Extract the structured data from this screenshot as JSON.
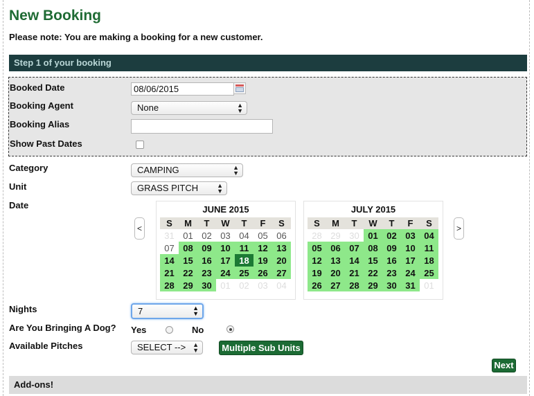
{
  "page": {
    "title": "New Booking",
    "note": "Please note: You are making a booking for a new customer.",
    "step_title": "Step 1 of your booking"
  },
  "form": {
    "booked_date_label": "Booked Date",
    "booked_date_value": "08/06/2015",
    "booking_agent_label": "Booking Agent",
    "booking_agent_value": "None",
    "booking_alias_label": "Booking Alias",
    "booking_alias_value": "",
    "show_past_dates_label": "Show Past Dates",
    "category_label": "Category",
    "category_value": "CAMPING",
    "unit_label": "Unit",
    "unit_value": "GRASS PITCH",
    "date_label": "Date",
    "nights_label": "Nights",
    "nights_value": "7",
    "dog_label": "Are You Bringing A Dog?",
    "dog_yes": "Yes",
    "dog_no": "No",
    "dog_selected": "No",
    "pitches_label": "Available Pitches",
    "pitches_value": "SELECT -->",
    "multiple_sub_units_label": "Multiple Sub Units",
    "next_label": "Next"
  },
  "calendar": {
    "prev_label": "<",
    "next_label": ">",
    "weekdays": [
      "S",
      "M",
      "T",
      "W",
      "T",
      "F",
      "S"
    ],
    "months": [
      {
        "title": "JUNE 2015",
        "weeks": [
          [
            [
              "31",
              "out"
            ],
            [
              "01",
              "past"
            ],
            [
              "02",
              "past"
            ],
            [
              "03",
              "past"
            ],
            [
              "04",
              "past"
            ],
            [
              "05",
              "past"
            ],
            [
              "06",
              "past"
            ]
          ],
          [
            [
              "07",
              "past"
            ],
            [
              "08",
              "avail"
            ],
            [
              "09",
              "avail"
            ],
            [
              "10",
              "avail"
            ],
            [
              "11",
              "avail"
            ],
            [
              "12",
              "avail"
            ],
            [
              "13",
              "avail"
            ]
          ],
          [
            [
              "14",
              "avail"
            ],
            [
              "15",
              "avail"
            ],
            [
              "16",
              "avail"
            ],
            [
              "17",
              "avail"
            ],
            [
              "18",
              "today"
            ],
            [
              "19",
              "avail"
            ],
            [
              "20",
              "avail"
            ]
          ],
          [
            [
              "21",
              "avail"
            ],
            [
              "22",
              "avail"
            ],
            [
              "23",
              "avail"
            ],
            [
              "24",
              "avail"
            ],
            [
              "25",
              "avail"
            ],
            [
              "26",
              "avail"
            ],
            [
              "27",
              "avail"
            ]
          ],
          [
            [
              "28",
              "avail"
            ],
            [
              "29",
              "avail"
            ],
            [
              "30",
              "avail"
            ],
            [
              "01",
              "out"
            ],
            [
              "02",
              "out"
            ],
            [
              "03",
              "out"
            ],
            [
              "04",
              "out"
            ]
          ]
        ]
      },
      {
        "title": "JULY 2015",
        "weeks": [
          [
            [
              "28",
              "out"
            ],
            [
              "29",
              "out"
            ],
            [
              "30",
              "out"
            ],
            [
              "01",
              "avail"
            ],
            [
              "02",
              "avail"
            ],
            [
              "03",
              "avail"
            ],
            [
              "04",
              "avail"
            ]
          ],
          [
            [
              "05",
              "avail"
            ],
            [
              "06",
              "avail"
            ],
            [
              "07",
              "avail"
            ],
            [
              "08",
              "avail"
            ],
            [
              "09",
              "avail"
            ],
            [
              "10",
              "avail"
            ],
            [
              "11",
              "avail"
            ]
          ],
          [
            [
              "12",
              "avail"
            ],
            [
              "13",
              "avail"
            ],
            [
              "14",
              "avail"
            ],
            [
              "15",
              "avail"
            ],
            [
              "16",
              "avail"
            ],
            [
              "17",
              "avail"
            ],
            [
              "18",
              "avail"
            ]
          ],
          [
            [
              "19",
              "avail"
            ],
            [
              "20",
              "avail"
            ],
            [
              "21",
              "avail"
            ],
            [
              "22",
              "avail"
            ],
            [
              "23",
              "avail"
            ],
            [
              "24",
              "avail"
            ],
            [
              "25",
              "avail"
            ]
          ],
          [
            [
              "26",
              "avail"
            ],
            [
              "27",
              "avail"
            ],
            [
              "28",
              "avail"
            ],
            [
              "29",
              "avail"
            ],
            [
              "30",
              "avail"
            ],
            [
              "31",
              "avail"
            ],
            [
              "01",
              "out"
            ]
          ]
        ]
      }
    ]
  },
  "addons": {
    "title": "Add-ons!"
  },
  "colors": {
    "title_green": "#1f6b34",
    "step_bar": "#1c3d3f",
    "available_day": "#8ee88a",
    "today_day": "#1c7a34"
  },
  "icons": {
    "calendar_picker": "calendar-icon",
    "select_arrows": "updown-arrow-icon"
  }
}
